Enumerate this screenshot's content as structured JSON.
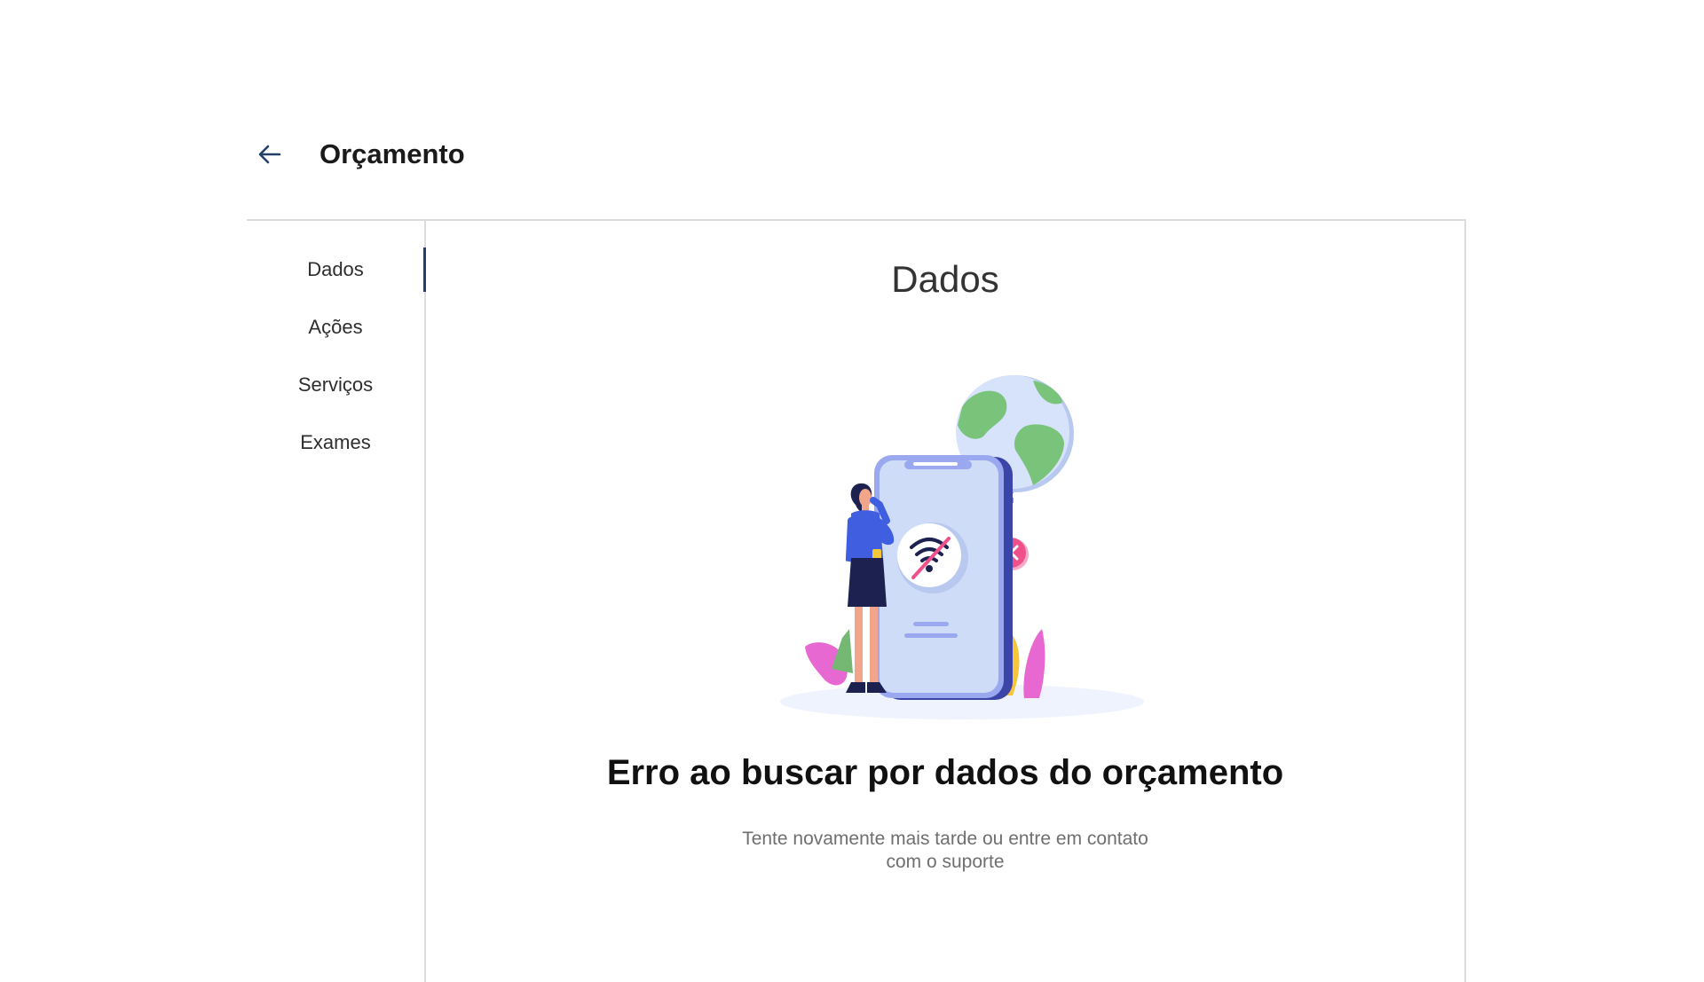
{
  "header": {
    "back_icon": "arrow-left-icon",
    "title": "Orçamento"
  },
  "sidebar": {
    "items": [
      {
        "label": "Dados",
        "active": true
      },
      {
        "label": "Ações",
        "active": false
      },
      {
        "label": "Serviços",
        "active": false
      },
      {
        "label": "Exames",
        "active": false
      }
    ]
  },
  "main": {
    "section_title": "Dados",
    "error": {
      "illustration": "no-connection-illustration",
      "title": "Erro ao buscar por dados do orçamento",
      "description": "Tente novamente mais tarde ou entre em contato com o suporte"
    }
  },
  "colors": {
    "accent": "#23406b",
    "border": "#dcdcdc",
    "error_pink": "#f0508a",
    "phone_blue": "#cfdcf8",
    "globe_green": "#79c47a"
  }
}
